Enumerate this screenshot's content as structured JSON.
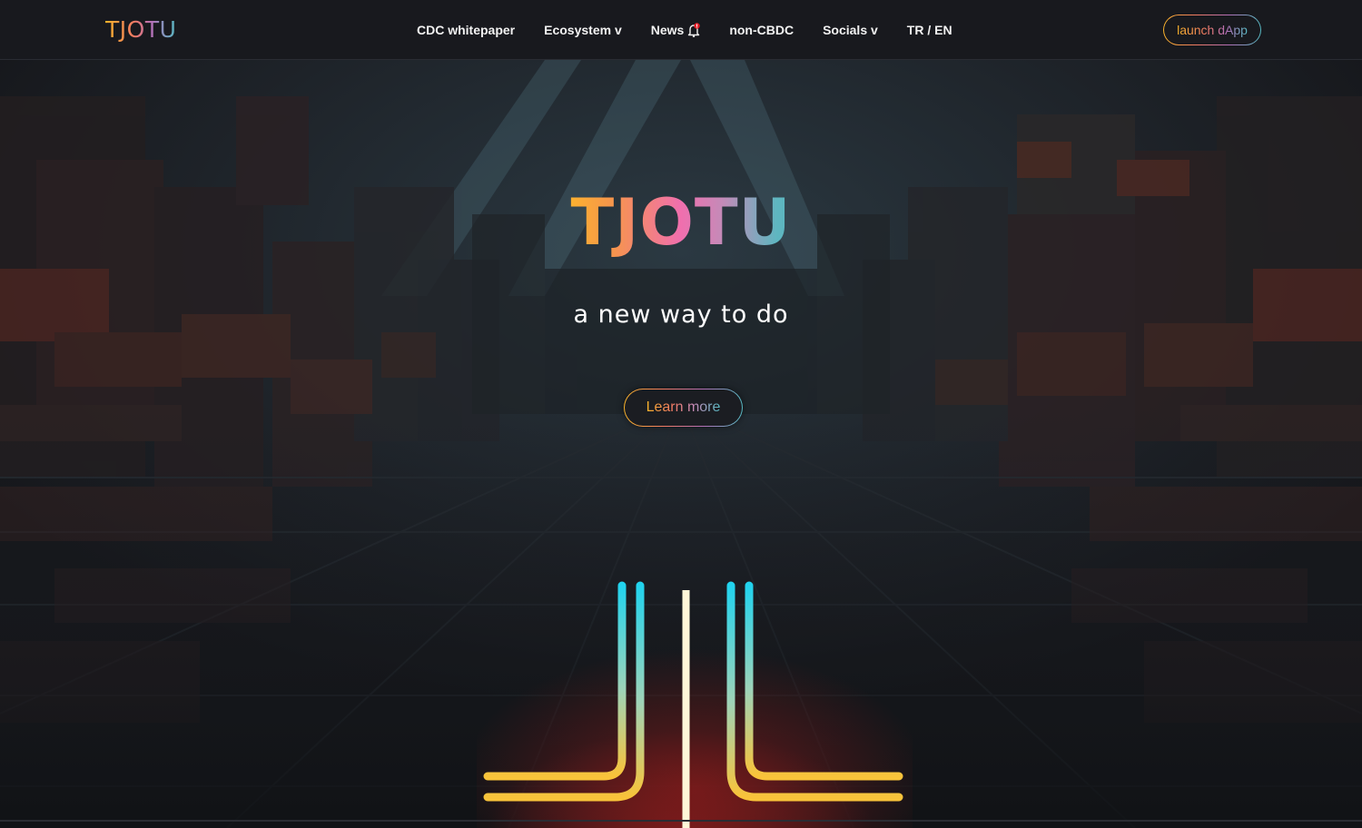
{
  "header": {
    "logo_text": "TJOTU",
    "nav": [
      {
        "label": "CDC whitepaper"
      },
      {
        "label": "Ecosystem v"
      },
      {
        "label": "News",
        "icon": "bell-notification-icon"
      },
      {
        "label": "non-CBDC"
      },
      {
        "label": "Socials v"
      },
      {
        "label": "TR / EN"
      }
    ],
    "launch_label": "launch dApp"
  },
  "hero": {
    "title": "TJOTU",
    "subtitle": "a new way to do",
    "cta_label": "Learn more"
  },
  "colors": {
    "background": "#17181d",
    "gradient": [
      "#ffc21f",
      "#f27b63",
      "#f06fae",
      "#56b9c2"
    ],
    "emblem_cyan": "#22d3ee",
    "emblem_yellow": "#f8c33a"
  }
}
